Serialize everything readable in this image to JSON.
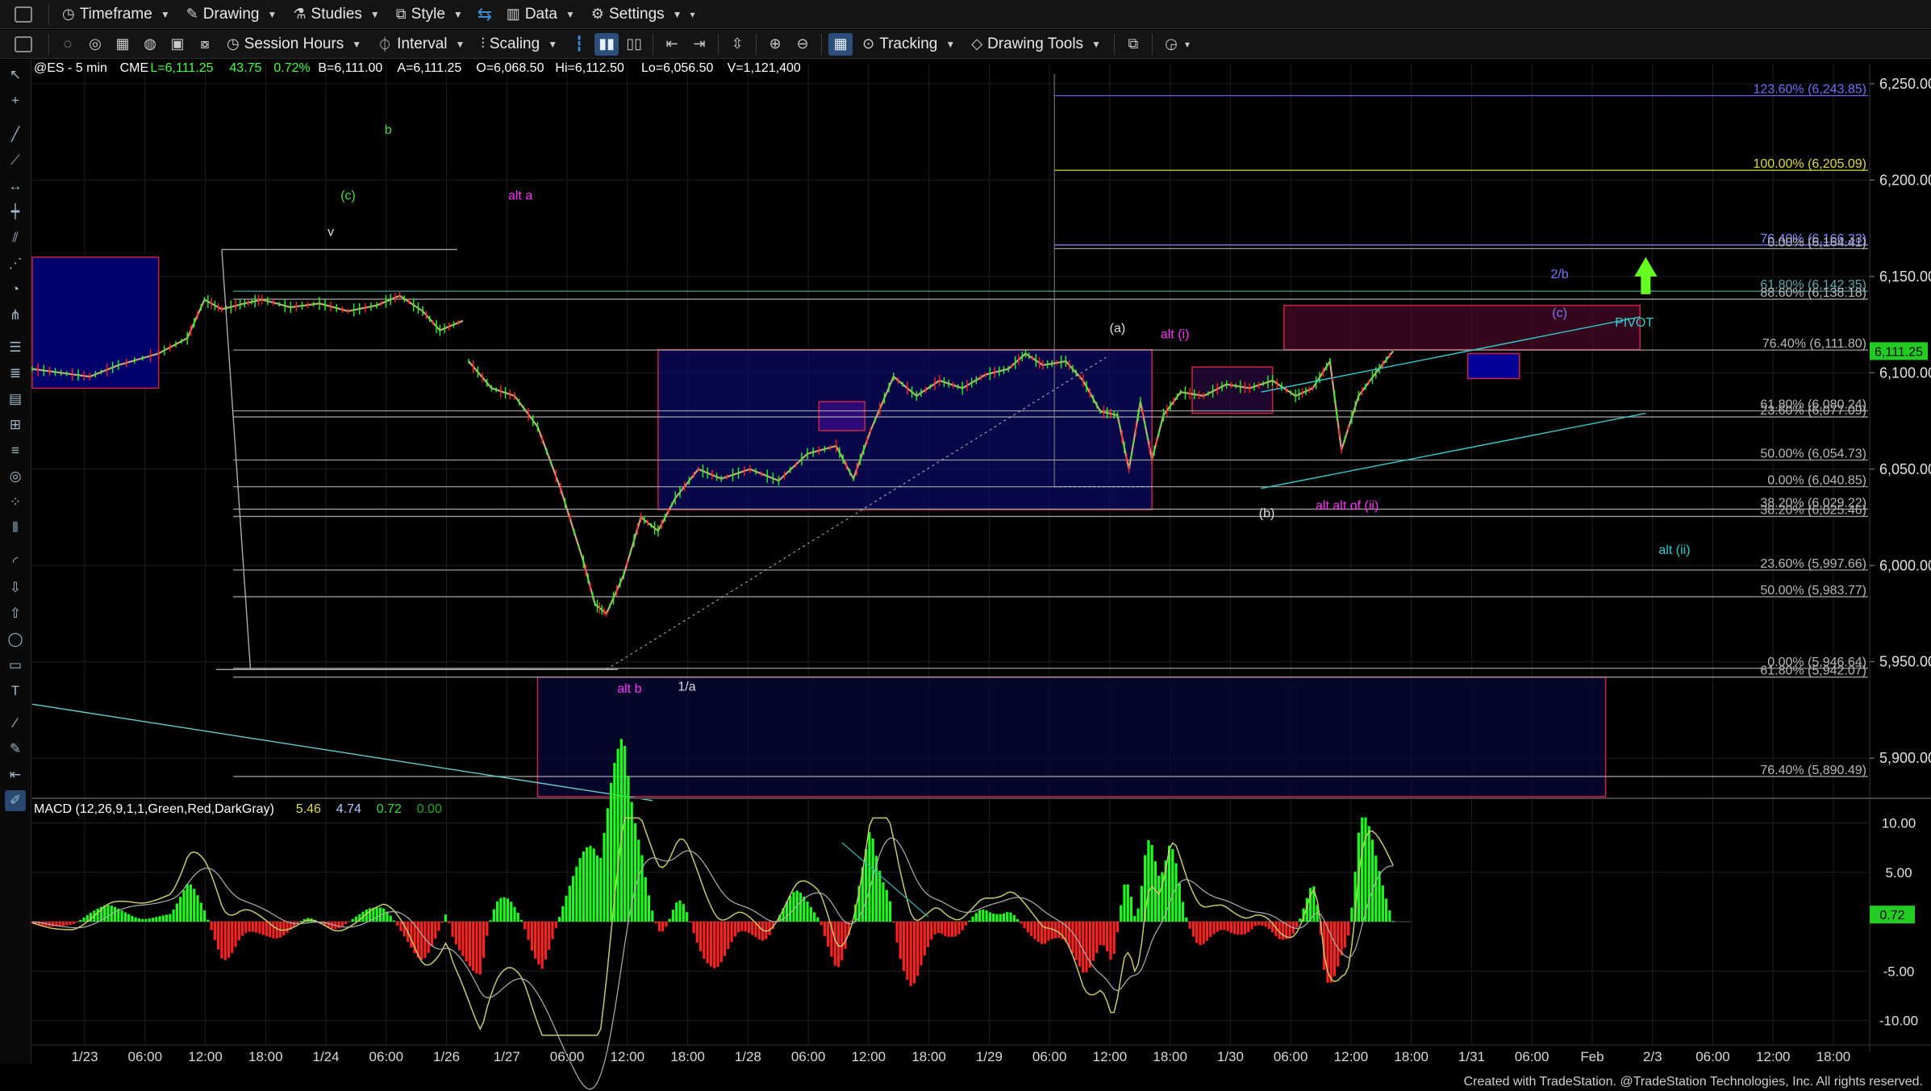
{
  "toolbar1": {
    "items": [
      {
        "name": "timeframe-menu",
        "icon": "clock-icon",
        "glyph": "◷",
        "label": "Timeframe"
      },
      {
        "name": "drawing-menu",
        "icon": "pencil-icon",
        "glyph": "✎",
        "label": "Drawing"
      },
      {
        "name": "studies-menu",
        "icon": "flask-icon",
        "glyph": "⚗",
        "label": "Studies"
      },
      {
        "name": "style-menu",
        "icon": "style-icon",
        "glyph": "⧉",
        "label": "Style"
      },
      {
        "name": "data-menu",
        "icon": "bar-chart-icon",
        "glyph": "▥",
        "label": "Data"
      },
      {
        "name": "settings-menu",
        "icon": "gear-icon",
        "glyph": "⚙",
        "label": "Settings"
      }
    ]
  },
  "toolbar2": {
    "session_hours": "Session Hours",
    "interval": "Interval",
    "scaling": "Scaling",
    "tracking": "Tracking",
    "drawing_tools": "Drawing Tools"
  },
  "colors": {
    "background": "#000000",
    "up": "#1aff1a",
    "down": "#ff2020",
    "candle_body": "#c8a878",
    "price_tag": "#22cc22",
    "macd_line": "#c9c96a",
    "signal_line": "#b0b0b0",
    "box_blue": "#000066",
    "box_red": "#4a0020",
    "magenta": "#ff33ff",
    "green_label": "#44dd44",
    "cyan_label": "#33cccc",
    "grid": "#1e1e1e"
  },
  "header": {
    "symbol": "@ES - 5 min",
    "exchange": "CME",
    "last": "L=6,111.25",
    "change": "43.75",
    "change_pct": "0.72%",
    "bid": "B=6,111.00",
    "ask": "A=6,111.25",
    "open": "O=6,068.50",
    "high": "Hi=6,112.50",
    "low": "Lo=6,056.50",
    "volume": "V=1,121,400"
  },
  "chart_data": [
    {
      "type": "line",
      "title": "@ES - 5 min",
      "ylim": [
        5880,
        6260
      ],
      "y_ticks": [
        "6,250.00",
        "6,200.00",
        "6,150.00",
        "6,100.00",
        "6,050.00",
        "6,000.00",
        "5,950.00",
        "5,900.00"
      ],
      "y_tick_values": [
        6250,
        6200,
        6150,
        6100,
        6050,
        6000,
        5950,
        5900
      ],
      "x_ticks": [
        "1/23",
        "06:00",
        "12:00",
        "18:00",
        "1/24",
        "06:00",
        "1/26",
        "1/27",
        "06:00",
        "12:00",
        "18:00",
        "1/28",
        "06:00",
        "12:00",
        "18:00",
        "1/29",
        "06:00",
        "12:00",
        "18:00",
        "1/30",
        "06:00",
        "12:00",
        "18:00",
        "1/31",
        "06:00",
        "Feb",
        "2/3",
        "06:00",
        "12:00",
        "18:00"
      ],
      "last_price_tag": "6,111.25",
      "last_price": 6111.25,
      "price_path": [
        {
          "t": 0.0,
          "p": 6102
        },
        {
          "t": 0.5,
          "p": 6100
        },
        {
          "t": 1.0,
          "p": 6098
        },
        {
          "t": 1.5,
          "p": 6104
        },
        {
          "t": 2.2,
          "p": 6110
        },
        {
          "t": 2.7,
          "p": 6118
        },
        {
          "t": 3.0,
          "p": 6138
        },
        {
          "t": 3.3,
          "p": 6133
        },
        {
          "t": 3.7,
          "p": 6136
        },
        {
          "t": 4.0,
          "p": 6138
        },
        {
          "t": 4.5,
          "p": 6134
        },
        {
          "t": 5.0,
          "p": 6136
        },
        {
          "t": 5.5,
          "p": 6132
        },
        {
          "t": 6.0,
          "p": 6135
        },
        {
          "t": 6.4,
          "p": 6140
        },
        {
          "t": 6.8,
          "p": 6132
        },
        {
          "t": 7.1,
          "p": 6122
        },
        {
          "t": 7.5,
          "p": 6127
        },
        {
          "t": 7.6,
          "p": 6106
        },
        {
          "t": 8.0,
          "p": 6092
        },
        {
          "t": 8.4,
          "p": 6088
        },
        {
          "t": 8.8,
          "p": 6072
        },
        {
          "t": 9.2,
          "p": 6040
        },
        {
          "t": 9.6,
          "p": 6002
        },
        {
          "t": 9.8,
          "p": 5980
        },
        {
          "t": 10.0,
          "p": 5975
        },
        {
          "t": 10.3,
          "p": 5995
        },
        {
          "t": 10.6,
          "p": 6025
        },
        {
          "t": 10.9,
          "p": 6018
        },
        {
          "t": 11.2,
          "p": 6035
        },
        {
          "t": 11.6,
          "p": 6050
        },
        {
          "t": 12.0,
          "p": 6045
        },
        {
          "t": 12.5,
          "p": 6050
        },
        {
          "t": 13.0,
          "p": 6044
        },
        {
          "t": 13.5,
          "p": 6058
        },
        {
          "t": 14.0,
          "p": 6062
        },
        {
          "t": 14.3,
          "p": 6045
        },
        {
          "t": 14.6,
          "p": 6070
        },
        {
          "t": 15.0,
          "p": 6098
        },
        {
          "t": 15.4,
          "p": 6088
        },
        {
          "t": 15.8,
          "p": 6096
        },
        {
          "t": 16.2,
          "p": 6092
        },
        {
          "t": 16.6,
          "p": 6099
        },
        {
          "t": 17.0,
          "p": 6102
        },
        {
          "t": 17.3,
          "p": 6110
        },
        {
          "t": 17.6,
          "p": 6104
        },
        {
          "t": 18.0,
          "p": 6106
        },
        {
          "t": 18.3,
          "p": 6096
        },
        {
          "t": 18.6,
          "p": 6080
        },
        {
          "t": 18.9,
          "p": 6078
        },
        {
          "t": 19.1,
          "p": 6050
        },
        {
          "t": 19.3,
          "p": 6085
        },
        {
          "t": 19.5,
          "p": 6055
        },
        {
          "t": 19.7,
          "p": 6078
        },
        {
          "t": 20.0,
          "p": 6090
        },
        {
          "t": 20.4,
          "p": 6088
        },
        {
          "t": 20.8,
          "p": 6094
        },
        {
          "t": 21.2,
          "p": 6092
        },
        {
          "t": 21.6,
          "p": 6096
        },
        {
          "t": 22.0,
          "p": 6088
        },
        {
          "t": 22.3,
          "p": 6092
        },
        {
          "t": 22.6,
          "p": 6106
        },
        {
          "t": 22.8,
          "p": 6060
        },
        {
          "t": 23.1,
          "p": 6088
        },
        {
          "t": 23.4,
          "p": 6100
        },
        {
          "t": 23.7,
          "p": 6111.25
        }
      ],
      "fib_levels": [
        {
          "label": "123.60% (6,243.85)",
          "value": 6243.85,
          "color": "#6e6eff"
        },
        {
          "label": "100.00% (6,205.09)",
          "value": 6205.09,
          "color": "#dddd33"
        },
        {
          "label": "76.40% (6,166.33)",
          "value": 6166.33,
          "color": "#8888ff"
        },
        {
          "label": "0.00% (6,164.41)",
          "value": 6164.41,
          "color": "#aaaaaa"
        },
        {
          "label": "61.80% (6,142.35)",
          "value": 6142.35,
          "color": "#55aaaa"
        },
        {
          "label": "88.60% (6,138.18)",
          "value": 6138.18,
          "color": "#aaaaaa"
        },
        {
          "label": "76.40% (6,111.80)",
          "value": 6111.8,
          "color": "#aaaaaa"
        },
        {
          "label": "61.80% (6,080.24)",
          "value": 6080.24,
          "color": "#aaaaaa"
        },
        {
          "label": "23.60% (6,077.09)",
          "value": 6077.09,
          "color": "#aaaaaa"
        },
        {
          "label": "50.00% (6,054.73)",
          "value": 6054.73,
          "color": "#aaaaaa"
        },
        {
          "label": "0.00% (6,040.85)",
          "value": 6040.85,
          "color": "#aaaaaa"
        },
        {
          "label": "38.20% (6,029.22)",
          "value": 6029.22,
          "color": "#aaaaaa"
        },
        {
          "label": "38.20% (6,025.46)",
          "value": 6025.46,
          "color": "#aaaaaa"
        },
        {
          "label": "23.60% (5,997.66)",
          "value": 5997.66,
          "color": "#aaaaaa"
        },
        {
          "label": "50.00% (5,983.77)",
          "value": 5983.77,
          "color": "#aaaaaa"
        },
        {
          "label": "0.00% (5,946.64)",
          "value": 5946.64,
          "color": "#aaaaaa"
        },
        {
          "label": "61.80% (5,942.07)",
          "value": 5942.07,
          "color": "#aaaaaa"
        },
        {
          "label": "76.40% (5,890.49)",
          "value": 5890.49,
          "color": "#aaaaaa"
        }
      ],
      "wave_labels": [
        {
          "text": "b",
          "t": 6.2,
          "p": 6224,
          "color": "#44dd44"
        },
        {
          "text": "(c)",
          "t": 5.5,
          "p": 6190,
          "color": "#44dd44"
        },
        {
          "text": "alt a",
          "t": 8.5,
          "p": 6190,
          "color": "#ff33ff"
        },
        {
          "text": "v",
          "t": 5.2,
          "p": 6171,
          "color": "#dddddd"
        },
        {
          "text": "(a)",
          "t": 18.9,
          "p": 6121,
          "color": "#dddddd"
        },
        {
          "text": "alt (i)",
          "t": 19.9,
          "p": 6118,
          "color": "#ff33ff"
        },
        {
          "text": "2/b",
          "t": 26.6,
          "p": 6149,
          "color": "#7777ff"
        },
        {
          "text": "(c)",
          "t": 26.6,
          "p": 6129,
          "color": "#7777ff"
        },
        {
          "text": "PIVOT",
          "t": 27.9,
          "p": 6124,
          "color": "#33cccc"
        },
        {
          "text": "(b)",
          "t": 21.5,
          "p": 6025,
          "color": "#dddddd"
        },
        {
          "text": "alt alt of (ii)",
          "t": 22.9,
          "p": 6029,
          "color": "#ff33ff"
        },
        {
          "text": "alt (ii)",
          "t": 28.6,
          "p": 6006,
          "color": "#33cccc"
        },
        {
          "text": "alt b",
          "t": 10.4,
          "p": 5934,
          "color": "#ff33ff"
        },
        {
          "text": "1/a",
          "t": 11.4,
          "p": 5935,
          "color": "#dddddd"
        }
      ]
    },
    {
      "type": "line",
      "title": "MACD (12,26,9,1,1,Green,Red,DarkGray)",
      "legend": [
        "5.46",
        "4.74",
        "0.72",
        "0.00"
      ],
      "legend_colors": [
        "#dddd44",
        "#aaccff",
        "#33dd33",
        "#22aa22"
      ],
      "ylim": [
        -12,
        12
      ],
      "y_ticks": [
        "10.00",
        "5.00",
        "-5.00",
        "-10.00"
      ],
      "y_tick_values": [
        10,
        5,
        -5,
        -10
      ],
      "last_tag": "0.72",
      "last_value": 0.72
    }
  ],
  "footer": "Created with TradeStation. @TradeStation Technologies, Inc. All rights reserved."
}
